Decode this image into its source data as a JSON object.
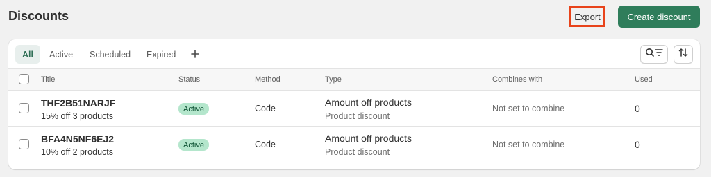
{
  "page": {
    "title": "Discounts",
    "export_label": "Export",
    "create_label": "Create discount"
  },
  "tabs": [
    {
      "label": "All",
      "active": true
    },
    {
      "label": "Active",
      "active": false
    },
    {
      "label": "Scheduled",
      "active": false
    },
    {
      "label": "Expired",
      "active": false
    }
  ],
  "icons": {
    "add_tab": "plus-icon",
    "search_filter": "search-filter-icon",
    "sort": "sort-icon"
  },
  "table": {
    "headers": {
      "title": "Title",
      "status": "Status",
      "method": "Method",
      "type": "Type",
      "combines": "Combines with",
      "used": "Used"
    },
    "rows": [
      {
        "code": "THF2B51NARJF",
        "summary": "15% off 3 products",
        "status": "Active",
        "method": "Code",
        "type": "Amount off products",
        "type_sub": "Product discount",
        "combines": "Not set to combine",
        "used": "0"
      },
      {
        "code": "BFA4N5NF6EJ2",
        "summary": "10% off 2 products",
        "status": "Active",
        "method": "Code",
        "type": "Amount off products",
        "type_sub": "Product discount",
        "combines": "Not set to combine",
        "used": "0"
      }
    ]
  },
  "colors": {
    "primary": "#2f7d5b",
    "highlight_border": "#e8431b",
    "badge_bg": "#b4e6cc",
    "badge_text": "#0c5132"
  }
}
